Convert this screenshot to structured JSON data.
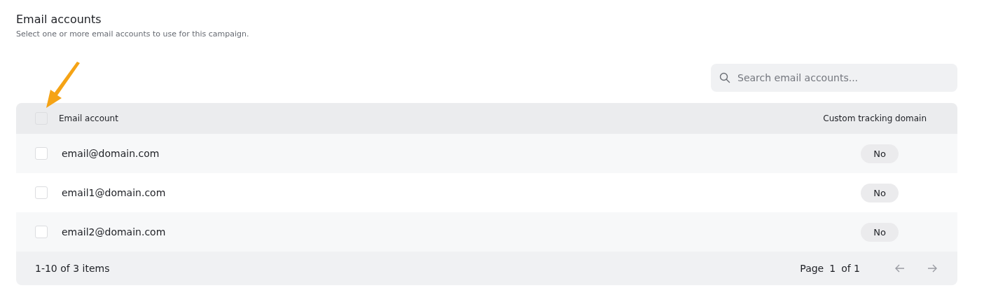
{
  "section": {
    "title": "Email accounts",
    "subtitle": "Select one or more email accounts to use for this campaign."
  },
  "search": {
    "placeholder": "Search email accounts..."
  },
  "table": {
    "select_all": {
      "checked": false
    },
    "columns": [
      "Email account",
      "Custom tracking domain"
    ],
    "rows": [
      {
        "email": "email@domain.com",
        "custom_tracking_domain": "No",
        "checked": false
      },
      {
        "email": "email1@domain.com",
        "custom_tracking_domain": "No",
        "checked": false
      },
      {
        "email": "email2@domain.com",
        "custom_tracking_domain": "No",
        "checked": false
      }
    ]
  },
  "footer": {
    "range": "1-10 of 3 items",
    "page_label": "Page",
    "page": "1",
    "page_total": "of 1"
  }
}
